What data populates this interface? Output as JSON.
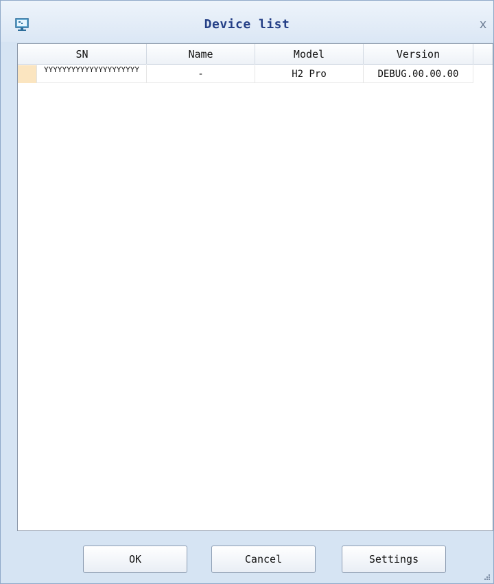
{
  "window": {
    "title": "Device list",
    "close_glyph": "x",
    "app_icon": "monitor-icon"
  },
  "table": {
    "columns": [
      "SN",
      "Name",
      "Model",
      "Version"
    ],
    "rows": [
      {
        "sn": "YYYYYYYYYYYYYYYYYYYYY",
        "name": "-",
        "model": "H2 Pro",
        "version": "DEBUG.00.00.00"
      }
    ]
  },
  "buttons": {
    "ok": "OK",
    "cancel": "Cancel",
    "settings": "Settings"
  },
  "colors": {
    "frame": "#d6e4f3",
    "title_text": "#243f86",
    "row_indicator": "#fbe5c0"
  }
}
